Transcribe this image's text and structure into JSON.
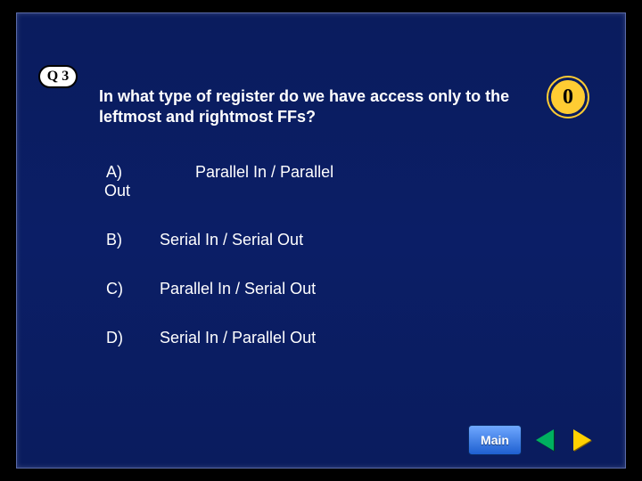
{
  "badge": "Q 3",
  "question": "In what type of register do we have access only to the leftmost and rightmost FFs?",
  "timer": "0",
  "options": {
    "a": {
      "label": "A)",
      "text_main": "Parallel In / Parallel",
      "text_wrap": "Out"
    },
    "b": {
      "label": "B)",
      "text": "Serial In / Serial Out"
    },
    "c": {
      "label": "C)",
      "text": "Parallel In / Serial Out"
    },
    "d": {
      "label": "D)",
      "text": "Serial In / Parallel Out"
    }
  },
  "nav": {
    "main": "Main"
  }
}
